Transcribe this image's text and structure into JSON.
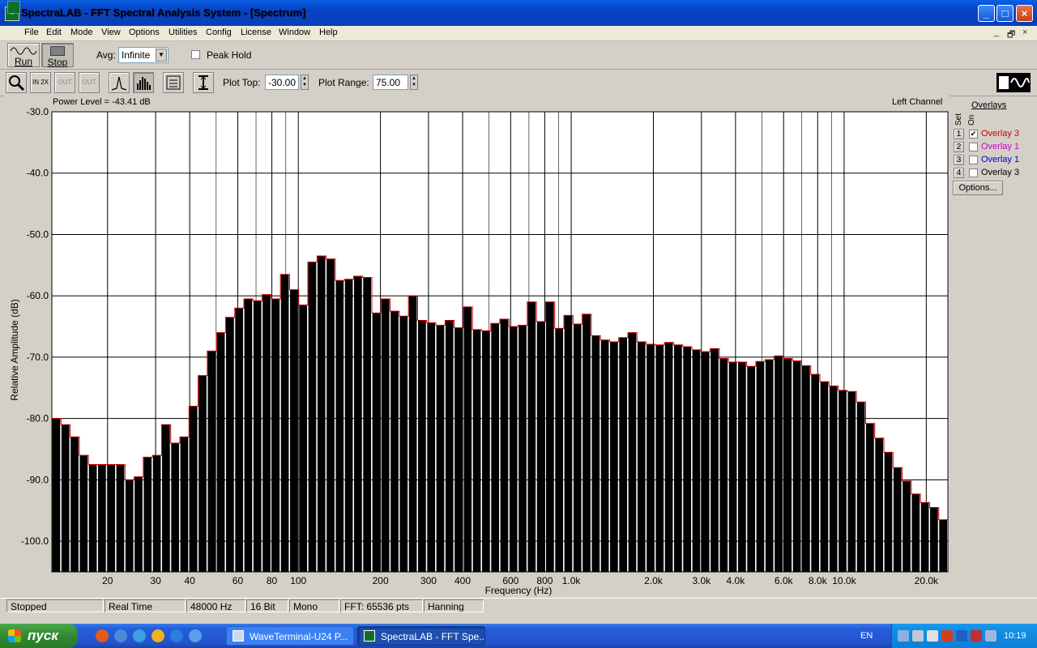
{
  "window": {
    "title": "SpectraLAB - FFT Spectral Analysis System - [Spectrum]",
    "controls": {
      "minimize": "_",
      "maximize": "□",
      "close": "×"
    }
  },
  "menu": {
    "items": [
      "File",
      "Edit",
      "Mode",
      "View",
      "Options",
      "Utilities",
      "Config",
      "License",
      "Window",
      "Help"
    ],
    "mdi_controls": [
      "_",
      "🗗",
      "×"
    ]
  },
  "toolbar": {
    "run_label": "Run",
    "stop_label": "Stop",
    "avg_label": "Avg:",
    "avg_value": "Infinite",
    "peak_hold_label": "Peak Hold",
    "peak_hold_checked": false,
    "zoom_in_2x": "IN 2X",
    "zoom_out_2x": "OUT 2X",
    "zoom_out_full": "OUT FULL",
    "plot_top_label": "Plot Top:",
    "plot_top_value": "-30.00",
    "plot_range_label": "Plot Range:",
    "plot_range_value": "75.00"
  },
  "chart": {
    "power_level": "Power Level = -43.41 dB",
    "channel": "Left Channel",
    "xlabel": "Frequency (Hz)",
    "ylabel": "Relative Amplitude (dB)"
  },
  "chart_data": {
    "type": "bar",
    "x_scale": "log",
    "xlim": [
      12.5,
      24000
    ],
    "ylim": [
      -105,
      -30
    ],
    "ylabel": "Relative Amplitude (dB)",
    "xlabel": "Frequency (Hz)",
    "y_ticks": [
      "-30.0",
      "-40.0",
      "-50.0",
      "-60.0",
      "-70.0",
      "-80.0",
      "-90.0",
      "-100.0"
    ],
    "x_ticks": [
      {
        "v": 20,
        "label": "20"
      },
      {
        "v": 30,
        "label": "30"
      },
      {
        "v": 40,
        "label": "40"
      },
      {
        "v": 60,
        "label": "60"
      },
      {
        "v": 80,
        "label": "80"
      },
      {
        "v": 100,
        "label": "100"
      },
      {
        "v": 200,
        "label": "200"
      },
      {
        "v": 300,
        "label": "300"
      },
      {
        "v": 400,
        "label": "400"
      },
      {
        "v": 600,
        "label": "600"
      },
      {
        "v": 800,
        "label": "800"
      },
      {
        "v": 1000,
        "label": "1.0k"
      },
      {
        "v": 2000,
        "label": "2.0k"
      },
      {
        "v": 3000,
        "label": "3.0k"
      },
      {
        "v": 4000,
        "label": "4.0k"
      },
      {
        "v": 6000,
        "label": "6.0k"
      },
      {
        "v": 8000,
        "label": "8.0k"
      },
      {
        "v": 10000,
        "label": "10.0k"
      },
      {
        "v": 20000,
        "label": "20.0k"
      }
    ],
    "grid": true,
    "bar_color": "#000000",
    "outline_color": "#d00000",
    "values": [
      -80,
      -81,
      -83,
      -86,
      -87.5,
      -87.5,
      -87.5,
      -87.5,
      -90,
      -89.5,
      -86.3,
      -86,
      -81,
      -84,
      -83,
      -78,
      -73,
      -69,
      -66,
      -63.5,
      -62,
      -60.5,
      -60.8,
      -59.8,
      -60.5,
      -56.5,
      -59,
      -61.5,
      -54.5,
      -53.5,
      -54,
      -57.5,
      -57.3,
      -56.8,
      -57,
      -62.8,
      -60.5,
      -62.5,
      -63.3,
      -60,
      -64,
      -64.4,
      -64.8,
      -64,
      -65.2,
      -61.8,
      -65.5,
      -65.7,
      -64.5,
      -63.8,
      -65,
      -64.8,
      -61,
      -64.2,
      -61,
      -65.3,
      -63.2,
      -64.6,
      -63,
      -66.5,
      -67.2,
      -67.5,
      -66.8,
      -66,
      -67.5,
      -67.9,
      -68,
      -67.6,
      -68,
      -68.3,
      -68.8,
      -69.1,
      -68.6,
      -70.2,
      -70.8,
      -70.8,
      -71.5,
      -70.7,
      -70.4,
      -69.8,
      -70.2,
      -70.6,
      -71.4,
      -72.8,
      -74,
      -74.7,
      -75.4,
      -75.6,
      -77.3,
      -80.8,
      -83.2,
      -85.5,
      -88,
      -90.2,
      -92.3,
      -93.7,
      -94.5,
      -96.5
    ]
  },
  "overlays": {
    "title": "Overlays",
    "set_header": "Set",
    "on_header": "On",
    "items": [
      {
        "set": "1",
        "name": "Overlay 3",
        "checked": true,
        "color": "#cc0000"
      },
      {
        "set": "2",
        "name": "Overlay 1",
        "checked": false,
        "color": "#cc00cc"
      },
      {
        "set": "3",
        "name": "Overlay 1",
        "checked": false,
        "color": "#0000cc"
      },
      {
        "set": "4",
        "name": "Overlay 3",
        "checked": false,
        "color": "#000000"
      }
    ],
    "options_label": "Options..."
  },
  "status": [
    "Stopped",
    "Real Time",
    "48000 Hz",
    "16 Bit",
    "Mono",
    "FFT: 65536 pts",
    "Hanning"
  ],
  "taskbar": {
    "start_label": "пуск",
    "tasks": [
      {
        "label": "WaveTerminal-U24 P...",
        "active": false
      },
      {
        "label": "SpectraLAB - FFT Spe...",
        "active": true
      }
    ],
    "language": "EN",
    "clock": "10:19"
  }
}
